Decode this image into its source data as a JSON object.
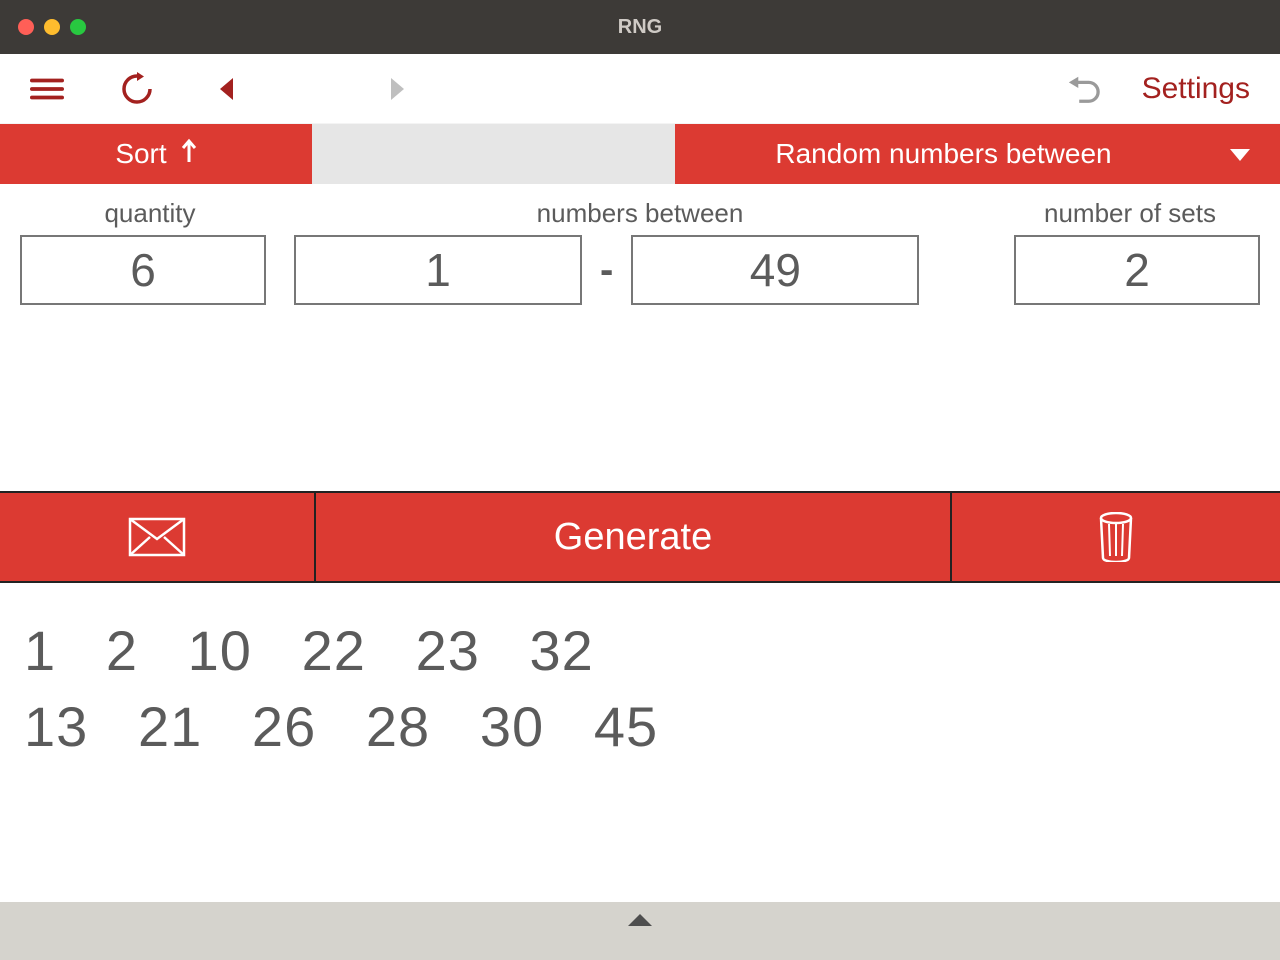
{
  "window": {
    "title": "RNG"
  },
  "toolbar": {
    "settings_label": "Settings"
  },
  "modebar": {
    "sort_label": "Sort",
    "mode_label": "Random numbers between"
  },
  "fields": {
    "quantity_label": "quantity",
    "between_label": "numbers between",
    "sets_label": "number of sets",
    "quantity_value": "6",
    "min_value": "1",
    "max_value": "49",
    "sets_value": "2",
    "dash": "-"
  },
  "actions": {
    "generate_label": "Generate"
  },
  "results": {
    "rows": [
      "1   2   10   22   23   32",
      "13   21   26   28   30   45"
    ]
  }
}
